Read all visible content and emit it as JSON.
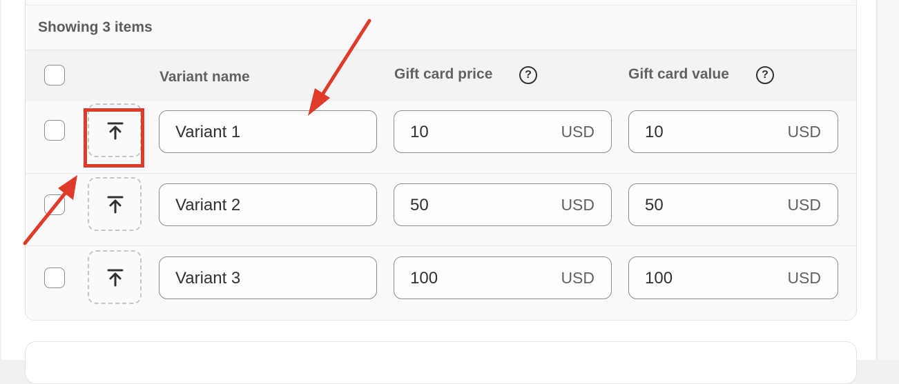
{
  "list": {
    "showing_label": "Showing 3 items"
  },
  "table": {
    "columns": {
      "variant_name": "Variant name",
      "gift_card_price": "Gift card price",
      "gift_card_value": "Gift card value"
    },
    "rows": [
      {
        "name": "Variant 1",
        "price": "10",
        "price_currency": "USD",
        "value": "10",
        "value_currency": "USD"
      },
      {
        "name": "Variant 2",
        "price": "50",
        "price_currency": "USD",
        "value": "50",
        "value_currency": "USD"
      },
      {
        "name": "Variant 3",
        "price": "100",
        "price_currency": "USD",
        "value": "100",
        "value_currency": "USD"
      }
    ]
  },
  "icons": {
    "help": "question-circle-icon",
    "upload": "upload-arrow-icon"
  },
  "help_glyph": "?",
  "annotation": {
    "color": "#e03a28"
  }
}
